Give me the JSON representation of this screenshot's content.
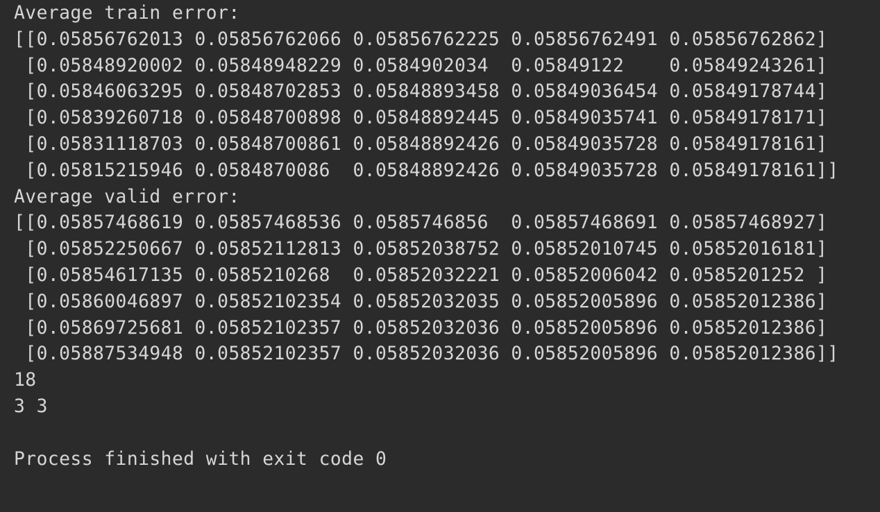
{
  "console": {
    "lines": [
      "Average train error:",
      "[[0.05856762013 0.05856762066 0.05856762225 0.05856762491 0.05856762862]",
      " [0.05848920002 0.05848948229 0.0584902034  0.05849122    0.05849243261]",
      " [0.05846063295 0.05848702853 0.05848893458 0.05849036454 0.05849178744]",
      " [0.05839260718 0.05848700898 0.05848892445 0.05849035741 0.05849178171]",
      " [0.05831118703 0.05848700861 0.05848892426 0.05849035728 0.05849178161]",
      " [0.05815215946 0.0584870086  0.05848892426 0.05849035728 0.05849178161]]",
      "Average valid error:",
      "[[0.05857468619 0.05857468536 0.0585746856  0.05857468691 0.05857468927]",
      " [0.05852250667 0.05852112813 0.05852038752 0.05852010745 0.05852016181]",
      " [0.05854617135 0.0585210268  0.05852032221 0.05852006042 0.0585201252 ]",
      " [0.05860046897 0.05852102354 0.05852032035 0.05852005896 0.05852012386]",
      " [0.05869725681 0.05852102357 0.05852032036 0.05852005896 0.05852012386]",
      " [0.05887534948 0.05852102357 0.05852032036 0.05852005896 0.05852012386]]",
      "18",
      "3 3",
      "",
      "Process finished with exit code 0"
    ]
  },
  "colors": {
    "background": "#2b2b2b",
    "text": "#d6d6d6"
  }
}
